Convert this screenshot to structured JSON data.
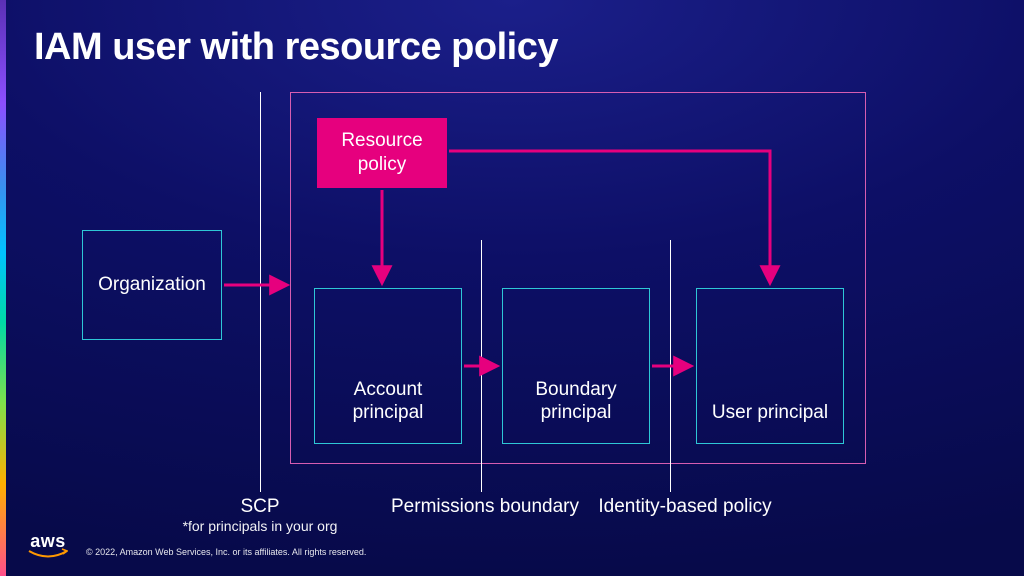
{
  "title": "IAM user with resource policy",
  "nodes": {
    "organization": "Organization",
    "resource_policy": "Resource policy",
    "account_principal": "Account principal",
    "boundary_principal": "Boundary principal",
    "user_principal": "User principal"
  },
  "dividers": {
    "scp": {
      "label": "SCP",
      "sublabel": "*for principals in your org"
    },
    "permissions_boundary": "Permissions boundary",
    "identity_policy": "Identity-based policy"
  },
  "footer": {
    "logo_text": "aws",
    "copyright": "© 2022, Amazon Web Services, Inc. or its affiliates. All rights reserved."
  },
  "colors": {
    "arrow": "#e6007e",
    "node_border": "#2ec7d6",
    "outer_border": "#d65db1",
    "swoosh": "#ff9900"
  }
}
